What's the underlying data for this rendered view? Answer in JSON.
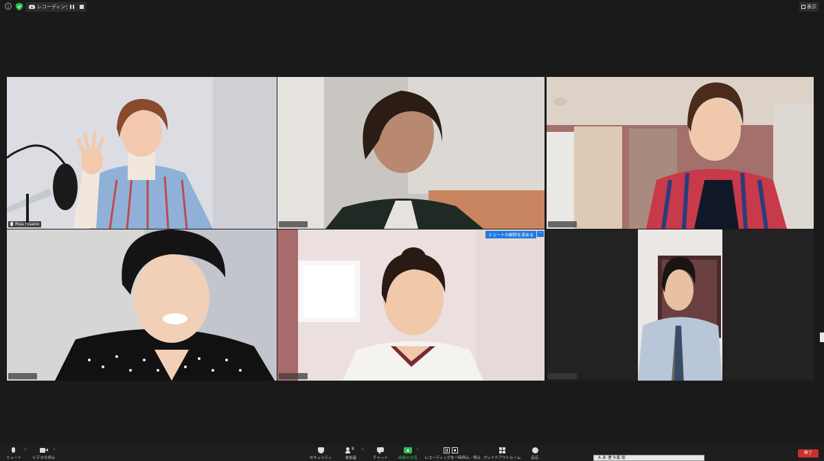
{
  "top_bar": {
    "recording_label": "レコーディング...",
    "view_label": "表示"
  },
  "participants": [
    {
      "name": "Risa Hisano",
      "active_speaker": true
    },
    {
      "name": ""
    },
    {
      "name": ""
    },
    {
      "name": ""
    },
    {
      "name": "",
      "unmute_request_label": "ミュートの解除を求める",
      "more_label": "···"
    },
    {
      "name": ""
    }
  ],
  "toolbar": {
    "mute": "ミュート",
    "stop_video": "ビデオの停止",
    "security": "セキュリティ",
    "participants": "参加者",
    "participants_count": "8",
    "chat": "チャット",
    "share_screen": "画面の共有",
    "recording": "レコーディングを一時停止／停止",
    "breakout": "ブレイクアウトルーム",
    "reactions": "反応",
    "end": "終了"
  },
  "ime_bar": {
    "text": "A  あ 連 R漢 般"
  },
  "colors": {
    "active_border": "#d9e86b",
    "share_green": "#2fbf4f",
    "unmute_blue": "#1f7ae0",
    "end_red": "#c9302c"
  }
}
